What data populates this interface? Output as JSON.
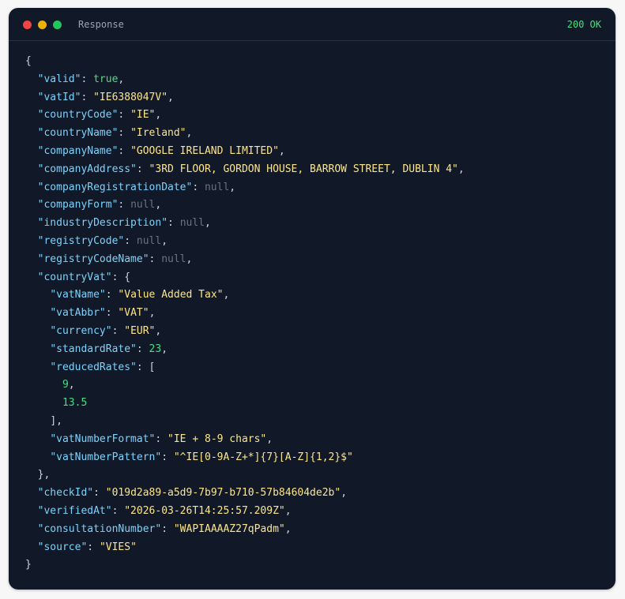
{
  "window": {
    "title": "Response",
    "status": "200 OK"
  },
  "lines": [
    {
      "indent": 0,
      "parts": [
        {
          "t": "{",
          "c": "p"
        }
      ]
    },
    {
      "indent": 1,
      "parts": [
        {
          "t": "\"valid\"",
          "c": "k"
        },
        {
          "t": ": ",
          "c": "p"
        },
        {
          "t": "true",
          "c": "b"
        },
        {
          "t": ",",
          "c": "p"
        }
      ]
    },
    {
      "indent": 1,
      "parts": [
        {
          "t": "\"vatId\"",
          "c": "k"
        },
        {
          "t": ": ",
          "c": "p"
        },
        {
          "t": "\"IE6388047V\"",
          "c": "s"
        },
        {
          "t": ",",
          "c": "p"
        }
      ]
    },
    {
      "indent": 1,
      "parts": [
        {
          "t": "\"countryCode\"",
          "c": "k"
        },
        {
          "t": ": ",
          "c": "p"
        },
        {
          "t": "\"IE\"",
          "c": "s"
        },
        {
          "t": ",",
          "c": "p"
        }
      ]
    },
    {
      "indent": 1,
      "parts": [
        {
          "t": "\"countryName\"",
          "c": "k"
        },
        {
          "t": ": ",
          "c": "p"
        },
        {
          "t": "\"Ireland\"",
          "c": "s"
        },
        {
          "t": ",",
          "c": "p"
        }
      ]
    },
    {
      "indent": 1,
      "parts": [
        {
          "t": "\"companyName\"",
          "c": "k"
        },
        {
          "t": ": ",
          "c": "p"
        },
        {
          "t": "\"GOOGLE IRELAND LIMITED\"",
          "c": "s"
        },
        {
          "t": ",",
          "c": "p"
        }
      ]
    },
    {
      "indent": 1,
      "parts": [
        {
          "t": "\"companyAddress\"",
          "c": "k"
        },
        {
          "t": ": ",
          "c": "p"
        },
        {
          "t": "\"3RD FLOOR, GORDON HOUSE, BARROW STREET, DUBLIN 4\"",
          "c": "s"
        },
        {
          "t": ",",
          "c": "p"
        }
      ]
    },
    {
      "indent": 1,
      "parts": [
        {
          "t": "\"companyRegistrationDate\"",
          "c": "k"
        },
        {
          "t": ": ",
          "c": "p"
        },
        {
          "t": "null",
          "c": "nl"
        },
        {
          "t": ",",
          "c": "p"
        }
      ]
    },
    {
      "indent": 1,
      "parts": [
        {
          "t": "\"companyForm\"",
          "c": "k"
        },
        {
          "t": ": ",
          "c": "p"
        },
        {
          "t": "null",
          "c": "nl"
        },
        {
          "t": ",",
          "c": "p"
        }
      ]
    },
    {
      "indent": 1,
      "parts": [
        {
          "t": "\"industryDescription\"",
          "c": "k"
        },
        {
          "t": ": ",
          "c": "p"
        },
        {
          "t": "null",
          "c": "nl"
        },
        {
          "t": ",",
          "c": "p"
        }
      ]
    },
    {
      "indent": 1,
      "parts": [
        {
          "t": "\"registryCode\"",
          "c": "k"
        },
        {
          "t": ": ",
          "c": "p"
        },
        {
          "t": "null",
          "c": "nl"
        },
        {
          "t": ",",
          "c": "p"
        }
      ]
    },
    {
      "indent": 1,
      "parts": [
        {
          "t": "\"registryCodeName\"",
          "c": "k"
        },
        {
          "t": ": ",
          "c": "p"
        },
        {
          "t": "null",
          "c": "nl"
        },
        {
          "t": ",",
          "c": "p"
        }
      ]
    },
    {
      "indent": 1,
      "parts": [
        {
          "t": "\"countryVat\"",
          "c": "k"
        },
        {
          "t": ": {",
          "c": "p"
        }
      ]
    },
    {
      "indent": 2,
      "parts": [
        {
          "t": "\"vatName\"",
          "c": "k"
        },
        {
          "t": ": ",
          "c": "p"
        },
        {
          "t": "\"Value Added Tax\"",
          "c": "s"
        },
        {
          "t": ",",
          "c": "p"
        }
      ]
    },
    {
      "indent": 2,
      "parts": [
        {
          "t": "\"vatAbbr\"",
          "c": "k"
        },
        {
          "t": ": ",
          "c": "p"
        },
        {
          "t": "\"VAT\"",
          "c": "s"
        },
        {
          "t": ",",
          "c": "p"
        }
      ]
    },
    {
      "indent": 2,
      "parts": [
        {
          "t": "\"currency\"",
          "c": "k"
        },
        {
          "t": ": ",
          "c": "p"
        },
        {
          "t": "\"EUR\"",
          "c": "s"
        },
        {
          "t": ",",
          "c": "p"
        }
      ]
    },
    {
      "indent": 2,
      "parts": [
        {
          "t": "\"standardRate\"",
          "c": "k"
        },
        {
          "t": ": ",
          "c": "p"
        },
        {
          "t": "23",
          "c": "n"
        },
        {
          "t": ",",
          "c": "p"
        }
      ]
    },
    {
      "indent": 2,
      "parts": [
        {
          "t": "\"reducedRates\"",
          "c": "k"
        },
        {
          "t": ": [",
          "c": "p"
        }
      ]
    },
    {
      "indent": 3,
      "parts": [
        {
          "t": "9",
          "c": "n"
        },
        {
          "t": ",",
          "c": "p"
        }
      ]
    },
    {
      "indent": 3,
      "parts": [
        {
          "t": "13.5",
          "c": "n"
        }
      ]
    },
    {
      "indent": 2,
      "parts": [
        {
          "t": "],",
          "c": "p"
        }
      ]
    },
    {
      "indent": 2,
      "parts": [
        {
          "t": "\"vatNumberFormat\"",
          "c": "k"
        },
        {
          "t": ": ",
          "c": "p"
        },
        {
          "t": "\"IE + 8-9 chars\"",
          "c": "s"
        },
        {
          "t": ",",
          "c": "p"
        }
      ]
    },
    {
      "indent": 2,
      "parts": [
        {
          "t": "\"vatNumberPattern\"",
          "c": "k"
        },
        {
          "t": ": ",
          "c": "p"
        },
        {
          "t": "\"^IE[0-9A-Z+*]{7}[A-Z]{1,2}$\"",
          "c": "s"
        }
      ]
    },
    {
      "indent": 1,
      "parts": [
        {
          "t": "},",
          "c": "p"
        }
      ]
    },
    {
      "indent": 1,
      "parts": [
        {
          "t": "\"checkId\"",
          "c": "k"
        },
        {
          "t": ": ",
          "c": "p"
        },
        {
          "t": "\"019d2a89-a5d9-7b97-b710-57b84604de2b\"",
          "c": "s"
        },
        {
          "t": ",",
          "c": "p"
        }
      ]
    },
    {
      "indent": 1,
      "parts": [
        {
          "t": "\"verifiedAt\"",
          "c": "k"
        },
        {
          "t": ": ",
          "c": "p"
        },
        {
          "t": "\"2026-03-26T14:25:57.209Z\"",
          "c": "s"
        },
        {
          "t": ",",
          "c": "p"
        }
      ]
    },
    {
      "indent": 1,
      "parts": [
        {
          "t": "\"consultationNumber\"",
          "c": "k"
        },
        {
          "t": ": ",
          "c": "p"
        },
        {
          "t": "\"WAPIAAAAZ27qPadm\"",
          "c": "s"
        },
        {
          "t": ",",
          "c": "p"
        }
      ]
    },
    {
      "indent": 1,
      "parts": [
        {
          "t": "\"source\"",
          "c": "k"
        },
        {
          "t": ": ",
          "c": "p"
        },
        {
          "t": "\"VIES\"",
          "c": "s"
        }
      ]
    },
    {
      "indent": 0,
      "parts": [
        {
          "t": "}",
          "c": "p"
        }
      ]
    }
  ],
  "colors": {
    "background": "#111827",
    "key": "#7dd3fc",
    "string": "#fde68a",
    "number": "#4ade80",
    "null": "#6b7280",
    "status": "#4ade80"
  }
}
